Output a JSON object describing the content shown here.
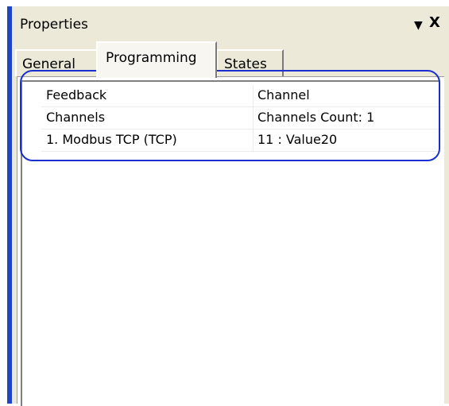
{
  "panel": {
    "title": "Properties",
    "pin_icon": "dropdown-arrow-icon",
    "close_icon": "close-icon",
    "pin_glyph": "▼",
    "close_glyph": "X"
  },
  "tabs": [
    {
      "label": "General"
    },
    {
      "label": "Programming"
    },
    {
      "label": "States"
    }
  ],
  "active_tab": "Programming",
  "properties": [
    {
      "name": "Feedback",
      "value": "Channel"
    },
    {
      "name": "Channels",
      "value": "Channels Count: 1"
    },
    {
      "name": "1. Modbus TCP (TCP)",
      "value": "11 : Value20"
    }
  ],
  "colors": {
    "accent_bar": "#1e45c8",
    "highlight_outline": "#1a2fd0",
    "panel_bg": "#ece9d8"
  }
}
